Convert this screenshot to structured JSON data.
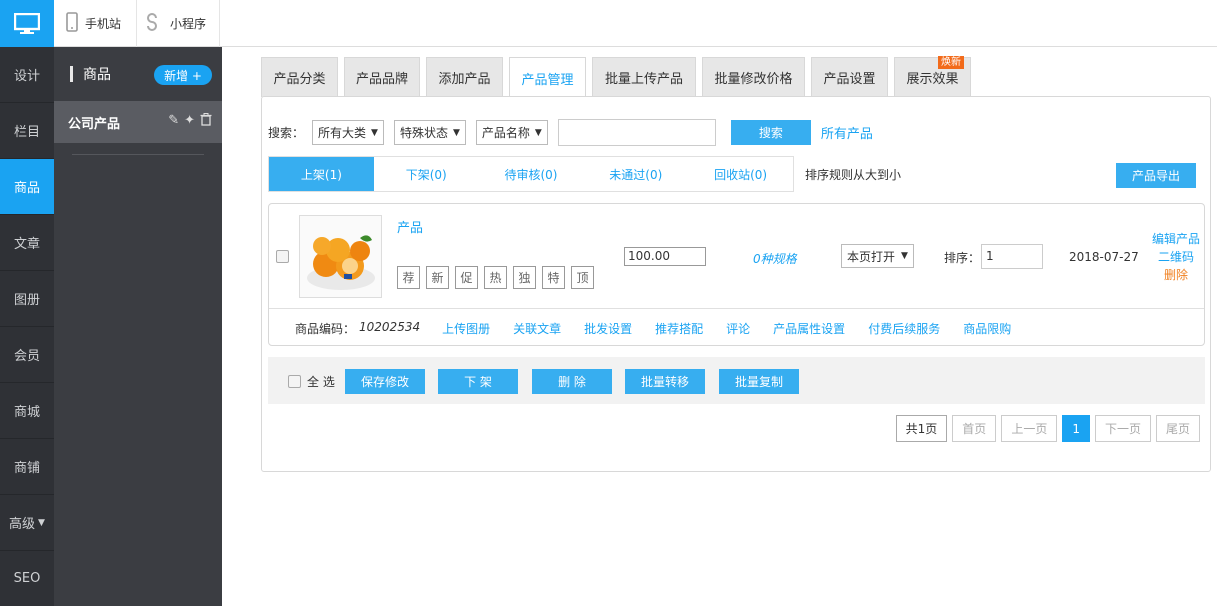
{
  "topbar": {
    "mobile_site": "手机站",
    "mini_program": "小程序"
  },
  "leftnav": {
    "items": [
      "设计",
      "栏目",
      "商品",
      "文章",
      "图册",
      "会员",
      "商城",
      "商铺",
      "高级",
      "SEO"
    ],
    "active_index": 2
  },
  "subsidebar": {
    "title": "商品",
    "add_label": "新增 +",
    "item": "公司产品"
  },
  "tabs": {
    "items": [
      "产品分类",
      "产品品牌",
      "添加产品",
      "产品管理",
      "批量上传产品",
      "批量修改价格",
      "产品设置",
      "展示效果"
    ],
    "active_index": 3,
    "new_tag": "焕新"
  },
  "search": {
    "label": "搜索：",
    "category": "所有大类",
    "status": "特殊状态",
    "field": "产品名称",
    "value": "",
    "button": "搜索",
    "all_link": "所有产品"
  },
  "status_tabs": [
    "上架(1)",
    "下架(0)",
    "待审核(0)",
    "未通过(0)",
    "回收站(0)"
  ],
  "sort_rule": "排序规则从大到小",
  "export_button": "产品导出",
  "product": {
    "name": "产品",
    "badges": [
      "荐",
      "新",
      "促",
      "热",
      "独",
      "特",
      "顶"
    ],
    "price": "100.00",
    "specs": "0种规格",
    "open_mode": "本页打开",
    "sort_label": "排序：",
    "sort_value": "1",
    "date": "2018-07-27",
    "actions": {
      "edit": "编辑产品",
      "qrcode": "二维码",
      "delete": "删除"
    },
    "code_label": "商品编码：",
    "code": "10202534",
    "links": [
      "上传图册",
      "关联文章",
      "批发设置",
      "推荐搭配",
      "评论",
      "产品属性设置",
      "付费后续服务",
      "商品限购"
    ]
  },
  "bottom": {
    "select_all": "全 选",
    "save": "保存修改",
    "off_shelf": "下 架",
    "delete": "删 除",
    "batch_move": "批量转移",
    "batch_copy": "批量复制"
  },
  "pager": {
    "total": "共1页",
    "first": "首页",
    "prev": "上一页",
    "current": "1",
    "next": "下一页",
    "last": "尾页"
  },
  "colors": {
    "accent": "#1aa3f2",
    "nav_bg": "#2f3136",
    "delete": "#f08020"
  }
}
